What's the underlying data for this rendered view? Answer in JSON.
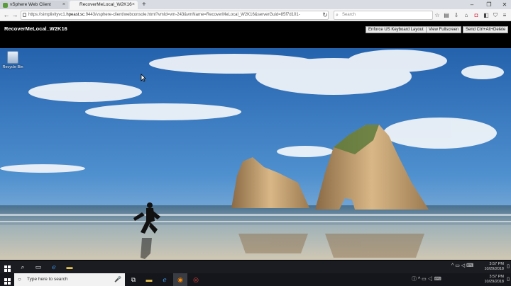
{
  "browser": {
    "tabs": [
      {
        "label": "vSphere Web Client",
        "close": "×"
      },
      {
        "label": "RecoverMeLocal_W2K16",
        "close": "×"
      }
    ],
    "new_tab": "+",
    "window_controls": {
      "minimize": "–",
      "maximize": "❐",
      "close": "✕"
    },
    "nav": {
      "back": "←",
      "forward": "→",
      "reload": "↻",
      "menu": "≡"
    },
    "url": {
      "prefix": "https://simplivityvc1.",
      "host": "hpeast.sc",
      "rest": ":9443/vsphere-client/webconsole.html?vmId=vm-243&vmName=RecoverMeLocal_W2K16&serverGuid=85f7d101-"
    },
    "search_placeholder": "Search",
    "toolbar_icons": [
      "star-icon",
      "reading-list-icon",
      "download-icon",
      "home-icon",
      "pocket-icon",
      "extension-icon"
    ]
  },
  "console": {
    "vm_title": "RecoverMeLocal_W2K16",
    "buttons": {
      "enforce_keyboard": "Enforce US Keyboard Layout",
      "view_fullscreen": "View Fullscreen",
      "send_cad": "Send Ctrl+Alt+Delete"
    }
  },
  "desktop": {
    "recycle_bin_label": "Recycle Bin"
  },
  "taskbar_top": {
    "clock_time": "3:57 PM",
    "clock_date": "10/29/2018"
  },
  "taskbar_bottom": {
    "search_placeholder": "Type here to search",
    "clock_time": "3:57 PM",
    "clock_date": "10/29/2018"
  },
  "colors": {
    "browser_chrome": "#f4f4f4",
    "console_header": "#000000",
    "taskbar": "#1a1c22",
    "sky": "#2b6fb6",
    "sea": "#5f7f97",
    "sand": "#b7b4a6"
  }
}
